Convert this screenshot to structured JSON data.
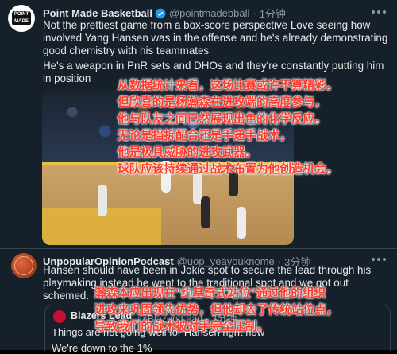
{
  "tweet1": {
    "avatar_text": "POINT MADE",
    "name": "Point Made Basketball",
    "handle": "@pointmadebball",
    "dot": "·",
    "time": "1分钟",
    "text1": "Not the prettiest game from a box-score perspective Love seeing how involved Yang Hansen was in the offense and he's already demonstrating good chemistry with his teammates",
    "text2": "He's a weapon in PnR sets and DHOs and they're constantly putting him in position",
    "overlay_lines": [
      "从数据统计来看，这场比赛或许不算精彩。",
      "但欣喜的是杨瀚森在进攻端的高度参与，",
      "他与队友之间已然展现出色的化学反应。",
      "无论是挡拆配合还是手递手战术，",
      "他是极具威胁的进攻武器。",
      "球队应该持续通过战术布置为他创造机会。"
    ]
  },
  "tweet2": {
    "name": "UnpopularOpinionPodcast",
    "handle": "@uop_yeayouknome",
    "dot": "·",
    "time": "3分钟",
    "text": "Hansen should have been in Jokic spot to  secure the lead through his playmaking instead he went to the traditional spot and we got out schemed.",
    "overlay_lines": [
      "瀚森本应出现在\"约基奇式站位\"通过他的组织",
      "进攻来巩固领先优势，但他却去了传统站位点，",
      "导致我们的战术被对手完全压制。"
    ],
    "quote": {
      "name": "Blazers Lead",
      "handle": "@BlazersLead · 3分钟",
      "text1": "Things are not going well for Hansen right now",
      "text2": "We're down to the 1%"
    }
  },
  "colors": {
    "background": "#15202b",
    "overlay_text": "#ff3a2a",
    "verified": "#1d9bf0"
  }
}
